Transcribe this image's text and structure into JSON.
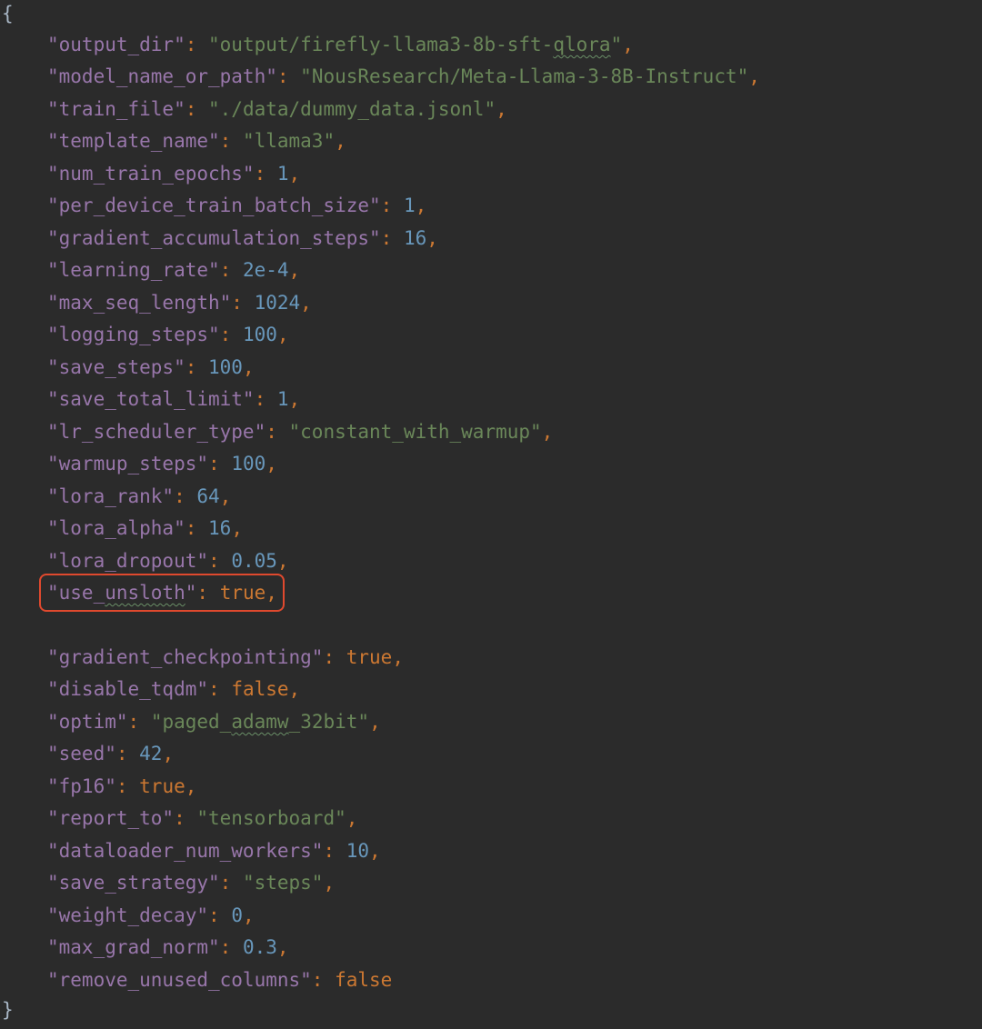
{
  "editor": {
    "open_brace": "{",
    "close_brace": "}",
    "entries": [
      {
        "key": "\"output_dir\"",
        "value": "\"output/firefly-llama3-8b-sft-",
        "value_squiggle": "qlora",
        "value_tail": "\"",
        "type": "str",
        "comma": ","
      },
      {
        "key": "\"model_name_or_path\"",
        "value": "\"NousResearch/Meta-Llama-3-8B-Instruct\"",
        "type": "str",
        "comma": ","
      },
      {
        "key": "\"train_file\"",
        "value": "\"./data/dummy_data.jsonl\"",
        "type": "str",
        "comma": ","
      },
      {
        "key": "\"template_name\"",
        "value": "\"llama3\"",
        "type": "str",
        "comma": ","
      },
      {
        "key": "\"num_train_epochs\"",
        "value": "1",
        "type": "num",
        "comma": ","
      },
      {
        "key": "\"per_device_train_batch_size\"",
        "value": "1",
        "type": "num",
        "comma": ","
      },
      {
        "key": "\"gradient_accumulation_steps\"",
        "value": "16",
        "type": "num",
        "comma": ","
      },
      {
        "key": "\"learning_rate\"",
        "value": "2e-4",
        "type": "num",
        "comma": ","
      },
      {
        "key": "\"max_seq_length\"",
        "value": "1024",
        "type": "num",
        "comma": ","
      },
      {
        "key": "\"logging_steps\"",
        "value": "100",
        "type": "num",
        "comma": ","
      },
      {
        "key": "\"save_steps\"",
        "value": "100",
        "type": "num",
        "comma": ","
      },
      {
        "key": "\"save_total_limit\"",
        "value": "1",
        "type": "num",
        "comma": ","
      },
      {
        "key": "\"lr_scheduler_type\"",
        "value": "\"constant_with_warmup\"",
        "type": "str",
        "comma": ","
      },
      {
        "key": "\"warmup_steps\"",
        "value": "100",
        "type": "num",
        "comma": ","
      },
      {
        "key": "\"lora_rank\"",
        "value": "64",
        "type": "num",
        "comma": ","
      },
      {
        "key": "\"lora_alpha\"",
        "value": "16",
        "type": "num",
        "comma": ","
      },
      {
        "key": "\"lora_dropout\"",
        "value": "0.05",
        "type": "num",
        "comma": ","
      },
      {
        "key_pre": "\"use_",
        "key_squiggle": "unsloth",
        "key_tail": "\"",
        "value": "true",
        "type": "kw",
        "comma": ",",
        "highlighted": true
      },
      {
        "key": "\"gradient_checkpointing\"",
        "value": "true",
        "type": "kw",
        "comma": ","
      },
      {
        "key": "\"disable_tqdm\"",
        "value": "false",
        "type": "kw",
        "comma": ","
      },
      {
        "key": "\"optim\"",
        "value": "\"paged_",
        "value_squiggle": "adamw",
        "value_tail": "_32bit\"",
        "type": "str",
        "comma": ","
      },
      {
        "key": "\"seed\"",
        "value": "42",
        "type": "num",
        "comma": ","
      },
      {
        "key": "\"fp16\"",
        "value": "true",
        "type": "kw",
        "comma": ","
      },
      {
        "key": "\"report_to\"",
        "value": "\"tensorboard\"",
        "type": "str",
        "comma": ","
      },
      {
        "key": "\"dataloader_num_workers\"",
        "value": "10",
        "type": "num",
        "comma": ","
      },
      {
        "key": "\"save_strategy\"",
        "value": "\"steps\"",
        "type": "str",
        "comma": ","
      },
      {
        "key": "\"weight_decay\"",
        "value": "0",
        "type": "num",
        "comma": ","
      },
      {
        "key": "\"max_grad_norm\"",
        "value": "0.3",
        "type": "num",
        "comma": ","
      },
      {
        "key": "\"remove_unused_columns\"",
        "value": "false",
        "type": "kw",
        "comma": ""
      }
    ],
    "colon": ": ",
    "colors": {
      "background": "#2b2b2b",
      "key": "#9876aa",
      "string": "#6a8759",
      "number": "#6897bb",
      "keyword": "#cc7832",
      "highlight_border": "#e0492e"
    }
  }
}
